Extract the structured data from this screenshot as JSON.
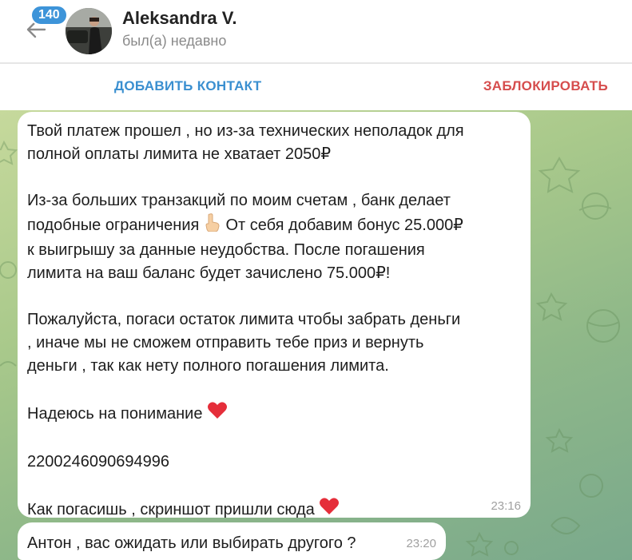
{
  "header": {
    "back_badge": "140",
    "contact_name": "Aleksandra V.",
    "status": "был(а) недавно"
  },
  "actions": {
    "add_contact": "ДОБАВИТЬ КОНТАКТ",
    "block": "ЗАБЛОКИРОВАТЬ"
  },
  "messages": [
    {
      "lines": {
        "l1": "Твой платеж прошел , но из-за технических неполадок для",
        "l2": "полной оплаты лимита не хватает 2050₽",
        "l3": "Из-за больших транзакций по моим счетам ,  банк делает",
        "l4a": "подобные ограничения",
        "l4b": "От себя добавим бонус 25.000₽",
        "l5": "к выигрышу за данные неудобства. После погашения",
        "l6": "лимита на ваш баланс будет зачислено 75.000₽!",
        "l7": "Пожалуйста, погаси остаток лимита чтобы забрать деньги",
        "l8": ", иначе мы не сможем отправить тебе приз и вернуть",
        "l9": "деньги , так как нету полного погашения лимита.",
        "l10": "Надеюсь на понимание",
        "l11": "2200246090694996",
        "l12": "Как погасишь , скриншот пришли сюда"
      },
      "time": "23:16"
    },
    {
      "text": "Антон , вас ожидать или выбирать другого ?",
      "time": "23:20"
    }
  ],
  "icons": [
    "back-arrow-icon",
    "pointing-up-hand-icon",
    "red-heart-icon"
  ],
  "colors": {
    "accent_blue": "#3a8fd0",
    "danger_red": "#d64d4d",
    "badge_blue": "#3d94d9",
    "chat_bg": "#a9c98b"
  }
}
